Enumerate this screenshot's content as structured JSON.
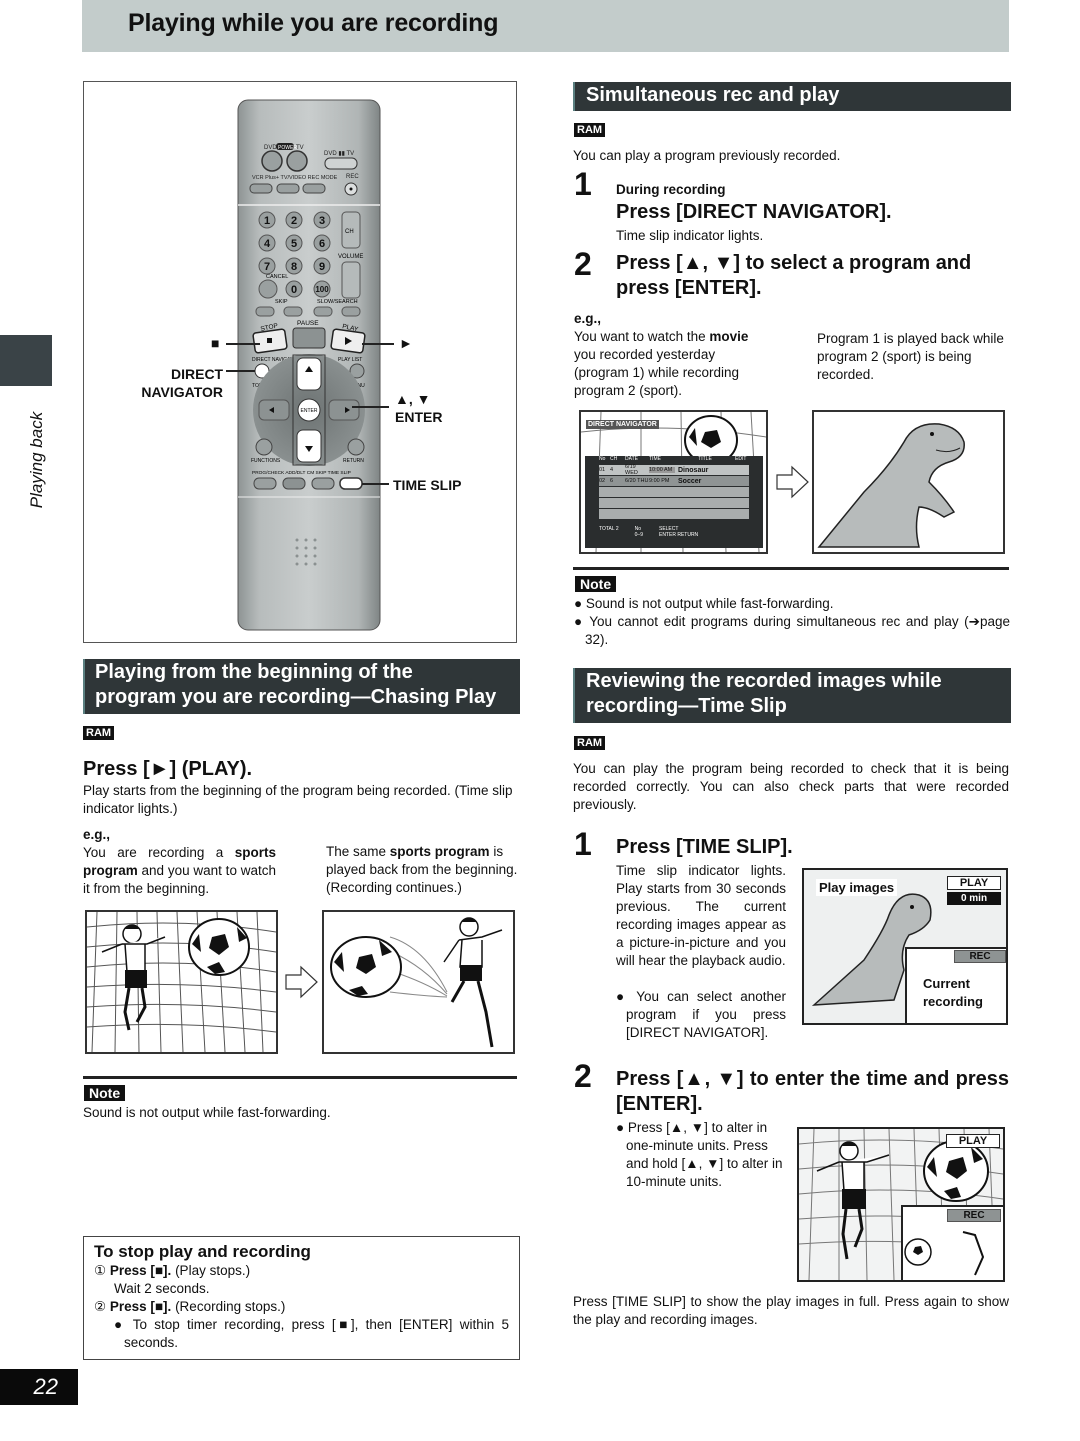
{
  "page": {
    "title": "Playing while you are recording",
    "side_label": "Playing back",
    "page_number": "22"
  },
  "remote": {
    "labels": {
      "stop_symbol": "■",
      "play_symbol": "►",
      "direct_navigator_1": "DIRECT",
      "direct_navigator_2": "NAVIGATOR",
      "up_down": "▲, ▼",
      "enter": "ENTER",
      "time_slip": "TIME SLIP"
    },
    "buttons": {
      "dvd_power_tv": "DVD POWER TV",
      "dvd_tv_switch": "DVD ▮▮ TV",
      "vcr_plus": "VCR Plus+",
      "tv_video": "TV/VIDEO",
      "rec_mode": "REC MODE",
      "rec": "REC",
      "digits": [
        "1",
        "2",
        "3",
        "4",
        "5",
        "6",
        "7",
        "8",
        "9",
        "0",
        "100"
      ],
      "ch": "CH",
      "volume": "VOLUME",
      "cancel": "CANCEL",
      "skip": "SKIP",
      "slow_search": "SLOW/SEARCH",
      "stop": "STOP",
      "pause": "PAUSE",
      "play": "PLAY",
      "direct_navigator": "DIRECT NAVIGATOR",
      "play_list": "PLAY LIST",
      "top_menu": "TOP MENU",
      "menu": "MENU",
      "enter": "ENTER",
      "functions": "FUNCTIONS",
      "return": "RETURN",
      "prog_check": "PROG/CHECK",
      "add_dlt": "ADD/DLT",
      "cm_skip": "CM SKIP",
      "time_slip": "TIME SLIP"
    }
  },
  "chasing": {
    "heading_line1": "Playing from the beginning of the",
    "heading_line2": "program you are recording—Chasing Play",
    "badge": "RAM",
    "step_head": "Press [►] (PLAY).",
    "desc": "Play starts from the beginning of the program being recorded. (Time slip indicator lights.)",
    "eg_label": "e.g.,",
    "eg_left_pre": "You are recording a ",
    "eg_left_bold": "sports program",
    "eg_left_post": " and you want to watch it from the beginning.",
    "eg_right_pre": "The same ",
    "eg_right_bold": "sports program",
    "eg_right_post": " is played back from the beginning. (Recording continues.)",
    "note_label": "Note",
    "note_text": "Sound is not output while fast-forwarding."
  },
  "stop_box": {
    "title": "To stop play and recording",
    "step1_num": "①",
    "step1_bold": "Press [■].",
    "step1_rest": " (Play stops.)",
    "step1_sub": "Wait 2 seconds.",
    "step2_num": "②",
    "step2_bold": "Press [■].",
    "step2_rest": " (Recording stops.)",
    "step2_bullet": "To stop timer recording, press [■], then [ENTER] within 5 seconds."
  },
  "simultaneous": {
    "heading": "Simultaneous rec and play",
    "badge": "RAM",
    "intro": "You can play a program previously recorded.",
    "step1_num": "1",
    "step1_sub": "During recording",
    "step1_head": "Press [DIRECT NAVIGATOR].",
    "step1_desc": "Time slip indicator lights.",
    "step2_num": "2",
    "step2_head": "Press [▲, ▼] to select a program and press [ENTER].",
    "eg_label": "e.g.,",
    "eg_left_pre": "You want to watch the ",
    "eg_left_bold": "movie",
    "eg_left_post": " you recorded yesterday (program 1) while recording program 2 (sport).",
    "eg_right": "Program 1 is played back while program 2 (sport) is being recorded.",
    "note_label": "Note",
    "notes": [
      "Sound is not output while fast-forwarding.",
      "You cannot edit programs during simultaneous rec and play (➔page 32)."
    ]
  },
  "direct_navigator_screen": {
    "title": "DIRECT NAVIGATOR",
    "columns": [
      "No",
      "CH",
      "DATE",
      "TIME",
      "TITLE",
      "EDIT"
    ],
    "rows": [
      {
        "no": "01",
        "ch": "4",
        "date": "6/19 WED",
        "time": "10:00 AM",
        "title": "Dinosaur"
      },
      {
        "no": "02",
        "ch": "6",
        "date": "6/20 THU",
        "time": "9:00 PM",
        "title": "Soccer"
      }
    ],
    "total": "TOTAL 2",
    "no_label": "No",
    "no_range_from": "0",
    "no_range_to": "9",
    "select": "SELECT",
    "enter": "ENTER",
    "return": "RETURN"
  },
  "timeslip": {
    "heading_line1": "Reviewing the recorded images while",
    "heading_line2": "recording—Time Slip",
    "badge": "RAM",
    "intro": "You can play the program being recorded to check that it is being recorded correctly. You can also check parts that were recorded previously.",
    "step1_num": "1",
    "step1_head": "Press [TIME SLIP].",
    "step1_desc": "Time slip indicator lights. Play starts from 30 seconds previous. The current recording images appear as a picture-in-picture and you will hear the playback audio.",
    "step1_bullet": "You can select another program if you press [DIRECT NAVIGATOR].",
    "screen1": {
      "play_images": "Play images",
      "play_badge": "PLAY",
      "time": "0 min",
      "rec_badge": "REC",
      "current_recording": "Current recording"
    },
    "step2_num": "2",
    "step2_head": "Press [▲, ▼] to enter the time and press [ENTER].",
    "step2_bullet": "Press [▲, ▼] to alter in one-minute units. Press and hold [▲, ▼] to alter in 10-minute units.",
    "screen2": {
      "play_badge": "PLAY",
      "rec_badge": "REC"
    },
    "footer": "Press [TIME SLIP] to show the play images in full. Press again to show the play and recording images."
  }
}
